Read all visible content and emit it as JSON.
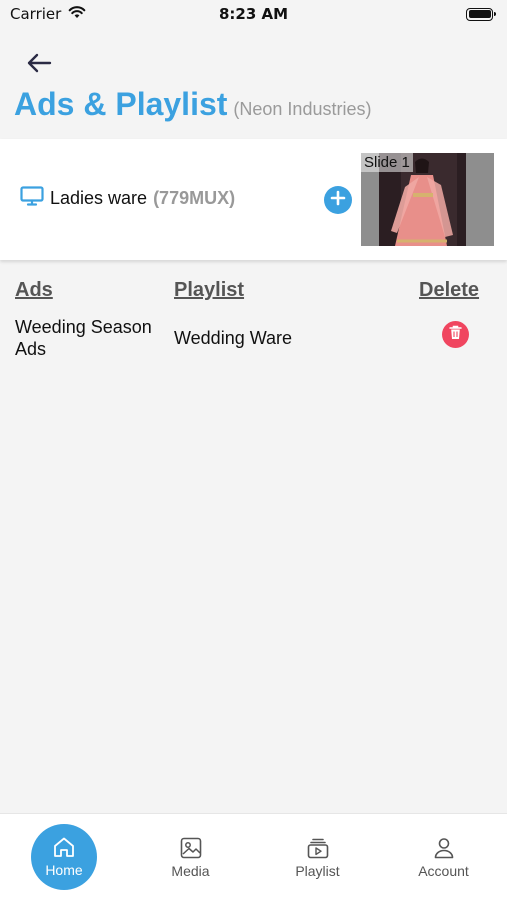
{
  "status_bar": {
    "carrier": "Carrier",
    "time": "8:23 AM",
    "battery_level": 1.0
  },
  "header": {
    "back_icon": "arrow-left-icon",
    "title": "Ads & Playlist",
    "subtitle": "(Neon Industries)"
  },
  "screen": {
    "icon": "monitor-icon",
    "name": "Ladies ware",
    "code": "(779MUX)",
    "add_icon": "plus-icon",
    "thumbnail_label": "Slide 1"
  },
  "table": {
    "columns": [
      "Ads",
      "Playlist",
      "Delete"
    ],
    "rows": [
      {
        "ad_line1": "Weeding Season",
        "ad_line2": "Ads",
        "playlist": "Wedding Ware",
        "delete_icon": "trash-icon"
      }
    ]
  },
  "tab_bar": {
    "tabs": [
      {
        "label": "Home",
        "icon": "home-icon",
        "active": true
      },
      {
        "label": "Media",
        "icon": "image-icon",
        "active": false
      },
      {
        "label": "Playlist",
        "icon": "playlist-icon",
        "active": false
      },
      {
        "label": "Account",
        "icon": "user-icon",
        "active": false
      }
    ]
  },
  "colors": {
    "accent": "#3ba1e0",
    "delete": "#f0455f",
    "muted": "#9a9a9a",
    "background": "#f4f4f4"
  }
}
